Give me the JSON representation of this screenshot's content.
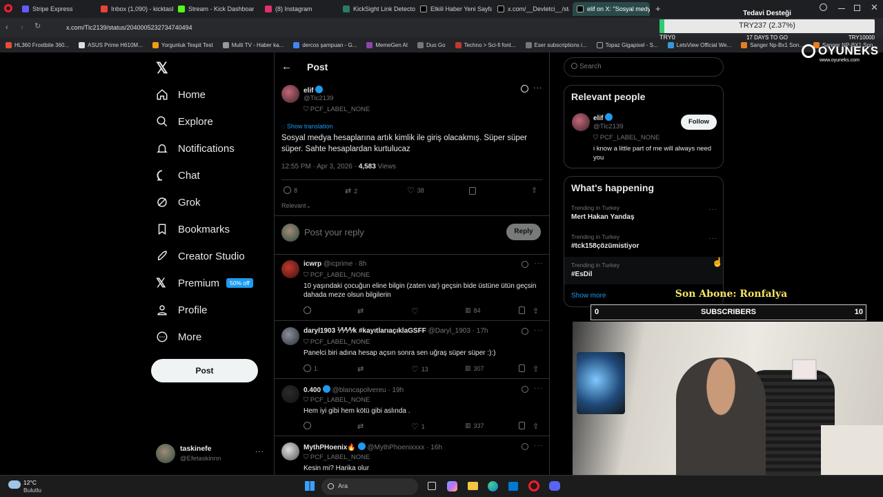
{
  "browser": {
    "tabs": [
      {
        "label": "Stripe Express",
        "color": "#635bff"
      },
      {
        "label": "Inbox (1,090) - kicktaskin",
        "color": "#ea4335"
      },
      {
        "label": "Stream - Kick Dashboard",
        "color": "#53fc18"
      },
      {
        "label": "(8) Instagram",
        "color": "#e1306c"
      },
      {
        "label": "KickSight Link Detector",
        "color": "#2a7a6a"
      },
      {
        "label": "Etkili Haber Yeni Sayfa on",
        "color": "#ffffff"
      },
      {
        "label": "x.com/__Devletci__/statu",
        "color": "#ffffff"
      },
      {
        "label": "elif on X: \"Sosyal medya h",
        "color": "#ffffff"
      }
    ],
    "url": "x.com/Tlc2139/status/2040005232734740494",
    "bookmarks": [
      "HL360 Frostbite 360...",
      "ASUS Prime H610M...",
      "Yorgunluk Tespit Test",
      "Multi TV - Haber ka...",
      "dercos şampuan - G...",
      "MemeGen AI",
      "Duo Go",
      "Techno > Sci-fi font...",
      "Eser subscriptions i...",
      "Topaz Gigapixel - S...",
      "LetsView Official We...",
      "Sanger Np-Bx1 Son...",
      "Sanger NP-BX1 Son..."
    ]
  },
  "overlay": {
    "donation_title": "Tedavi Desteği",
    "donation_amount": "TRY237 (2.37%)",
    "donation_left": "TRY0",
    "donation_days": "17 DAYS TO GO",
    "donation_goal": "TRY10000",
    "donation_progress": 0.0237,
    "brand": "OYUNEKS",
    "brand_url": "www.oyuneks.com",
    "last_sub": "Son Abone: Ronfalya",
    "sub_current": "0",
    "sub_label": "SUBSCRIBERS",
    "sub_goal": "10"
  },
  "nav": {
    "items": [
      "Home",
      "Explore",
      "Notifications",
      "Chat",
      "Grok",
      "Bookmarks",
      "Creator Studio",
      "Premium",
      "Profile",
      "More"
    ],
    "premium_badge": "50% off",
    "post_button": "Post",
    "account_name": "taskinefe",
    "account_handle": "@Efetaskinnn"
  },
  "post": {
    "header": "Post",
    "author_name": "elif",
    "author_handle": "@Tlc2139",
    "label": "PCF_LABEL_NONE",
    "show_translation": "Show translation",
    "text": "Sosyal medya hesaplarına artık kimlik ile giriş olacakmış. Süper süper süper. Sahte hesaplardan kurtulucaz",
    "meta": "12:55 PM · Apr 3, 2026 · ",
    "views_count": "4,583",
    "views_label": "Views",
    "replies": "8",
    "reposts": "2",
    "likes": "38",
    "sort": "Relevant",
    "reply_placeholder": "Post your reply",
    "reply_button": "Reply"
  },
  "replies": [
    {
      "name": "icwrp",
      "handle": "@icprime · 8h",
      "label": "PCF_LABEL_NONE",
      "text": "10 yaşındaki çocuğun eline bilgin (zaten var) geçsin bide üstüne ütün geçsin dahada meze olsun bilgilerin",
      "replies": "",
      "reposts": "",
      "likes": "",
      "views": "84"
    },
    {
      "name": "daryl1903 ⅟⅟⅟⅟k #kayıtlarıaçıklaGSFF",
      "handle": "@Daryl_1903 · 17h",
      "label": "PCF_LABEL_NONE",
      "text": "Panelci biri adına hesap açsın sonra sen uğraş süper süper :):)",
      "replies": "1",
      "reposts": "",
      "likes": "13",
      "views": "307"
    },
    {
      "name": "0.400",
      "handle": "@blancapolvereu · 19h",
      "label": "PCF_LABEL_NONE",
      "text": "Hem iyi gibi hem kötü gibi aslında .",
      "replies": "",
      "reposts": "",
      "likes": "1",
      "views": "337"
    },
    {
      "name": "MythPHoenix🔥",
      "handle": "@MythPhoenixxxx · 16h",
      "label": "PCF_LABEL_NONE",
      "text": "Kesin mi? Harika olur",
      "replies": "",
      "reposts": "",
      "likes": "",
      "views": ""
    }
  ],
  "sidebar": {
    "search_placeholder": "Search",
    "relevant_title": "Relevant people",
    "rp_name": "elif",
    "rp_handle": "@Tlc2139",
    "rp_label": "PCF_LABEL_NONE",
    "rp_bio": "i know a little part of me will always need you",
    "follow": "Follow",
    "happening_title": "What's happening",
    "trends": [
      {
        "category": "Trending in Turkey",
        "name": "Mert Hakan Yandaş"
      },
      {
        "category": "Trending in Turkey",
        "name": "#tck158çözümistiyor"
      },
      {
        "category": "Trending in Turkey",
        "name": "#EsDil"
      }
    ],
    "show_more": "Show more"
  },
  "taskbar": {
    "weather_temp": "12°C",
    "weather_desc": "Bulutlu",
    "search": "Ara"
  },
  "colors": {
    "accent": "#1d9bf0",
    "premium": "#1d9bf0",
    "overlay_green": "#2ecc71",
    "sub_yellow": "#f5e663"
  }
}
